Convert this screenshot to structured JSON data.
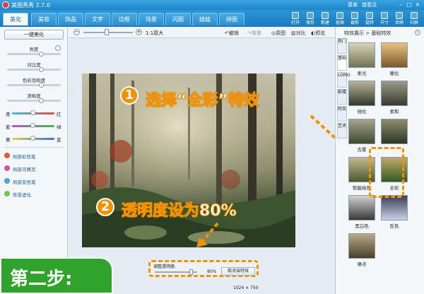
{
  "app": {
    "title": "美图秀秀 2.7.0"
  },
  "titlebar_links": [
    "菜单",
    "提意见"
  ],
  "window_controls": [
    "–",
    "□",
    "×"
  ],
  "tabs": [
    "美化",
    "美容",
    "饰品",
    "文字",
    "边框",
    "场景",
    "闪图",
    "娃娃",
    "拼图"
  ],
  "toolbar": [
    "打开",
    "保存",
    "新建",
    "抠图",
    "裁剪",
    "旋转",
    "尺寸",
    "涂鸦",
    "扫屏"
  ],
  "left_panel": {
    "one_click": "一键美化",
    "adjustments": [
      "亮度",
      "对比度",
      "色彩饱和度",
      "清晰度"
    ],
    "color_sliders": [
      {
        "left": "青",
        "right": "红"
      },
      {
        "left": "紫",
        "right": "绿"
      },
      {
        "left": "黄",
        "right": "蓝"
      }
    ],
    "pens": [
      "局部彩色笔",
      "局部马赛克",
      "局部变色笔",
      "背景虚化"
    ]
  },
  "canvas_toolbar": {
    "zoom_label": "1:1原大",
    "undo": "撤销",
    "redo": "重做",
    "original": "原图",
    "compare": "对比",
    "preview": "预览"
  },
  "annotations": {
    "step1_num": "1",
    "step1_text": "选择“全彩”特效",
    "step2_num": "2",
    "step2_text": "透明度设为80%",
    "banner": "第二步:"
  },
  "alpha_bar": {
    "label": "调整透明度:",
    "value": "80%",
    "cancel": "取消该特效",
    "value_fraction": 0.8
  },
  "image_size": "1024 × 750",
  "right_panel": {
    "breadcrumb": "特效展示 > 基础特效",
    "vtabs": [
      "热门",
      "基础",
      "LOMO",
      "影楼",
      "时尚",
      "艺术"
    ],
    "effects": [
      "柔光",
      "暖化",
      "锐化",
      "柔和",
      "去雾",
      "",
      "智能绘色",
      "全彩",
      "黑白色",
      "反色",
      "噪点"
    ]
  }
}
